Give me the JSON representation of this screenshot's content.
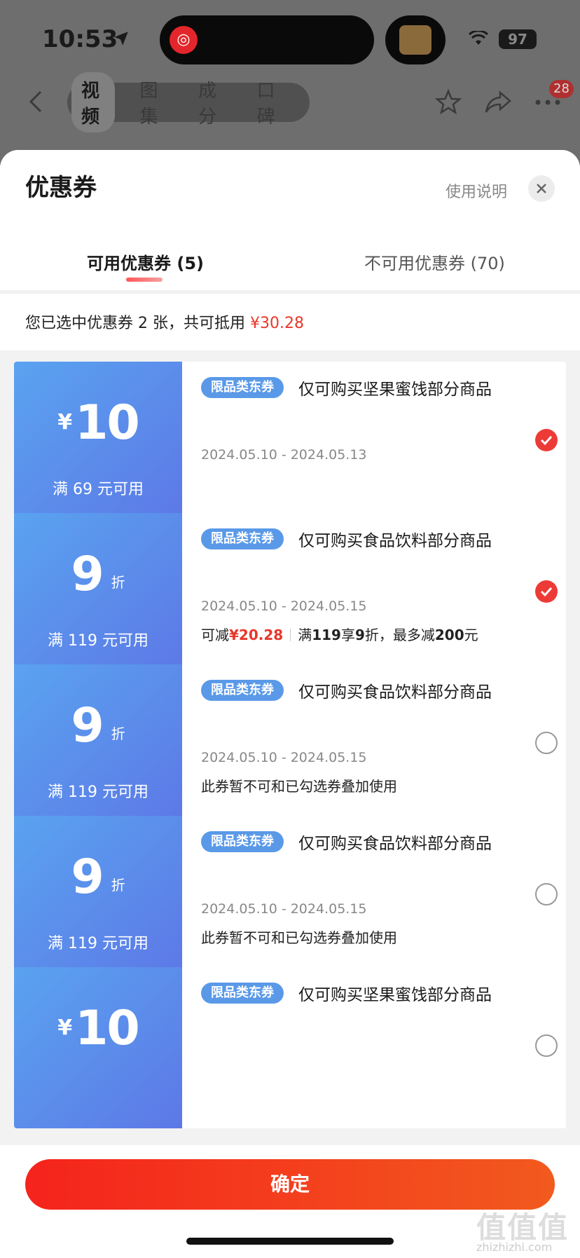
{
  "status": {
    "time": "10:53",
    "battery": "97"
  },
  "nav": {
    "tabs": [
      "视频",
      "图集",
      "成分",
      "口碑"
    ],
    "active_tab": "视频",
    "badge_count": "28"
  },
  "sheet": {
    "title": "优惠券",
    "help_link": "使用说明",
    "tab_available": "可用优惠券 (5)",
    "tab_unavailable": "不可用优惠券 (70)",
    "summary_prefix": "您已选中优惠券 2 张，共可抵用 ",
    "summary_amount": "¥30.28"
  },
  "coupons": [
    {
      "kind": "amount",
      "yen": "¥",
      "value": "10",
      "min_spend": "满 69 元可用",
      "tag": "限品类东券",
      "scope": "仅可购买坚果蜜饯部分商品",
      "dates": "2024.05.10 - 2024.05.13",
      "selected": true
    },
    {
      "kind": "discount",
      "value": "9",
      "unit": "折",
      "min_spend": "满 119 元可用",
      "tag": "限品类东券",
      "scope": "仅可购买食品饮料部分商品",
      "dates": "2024.05.10 - 2024.05.15",
      "detail_prefix": "可减",
      "detail_amount": "¥20.28",
      "detail_rule_a": "满",
      "detail_rule_b": "119",
      "detail_rule_c": "享",
      "detail_rule_d": "9",
      "detail_rule_e": "折，最多减",
      "detail_rule_f": "200",
      "detail_rule_g": "元",
      "selected": true
    },
    {
      "kind": "discount",
      "value": "9",
      "unit": "折",
      "min_spend": "满 119 元可用",
      "tag": "限品类东券",
      "scope": "仅可购买食品饮料部分商品",
      "dates": "2024.05.10 - 2024.05.15",
      "note": "此券暂不可和已勾选券叠加使用",
      "selected": false
    },
    {
      "kind": "discount",
      "value": "9",
      "unit": "折",
      "min_spend": "满 119 元可用",
      "tag": "限品类东券",
      "scope": "仅可购买食品饮料部分商品",
      "dates": "2024.05.10 - 2024.05.15",
      "note": "此券暂不可和已勾选券叠加使用",
      "selected": false
    },
    {
      "kind": "amount",
      "yen": "¥",
      "value": "10",
      "tag": "限品类东券",
      "scope": "仅可购买坚果蜜饯部分商品",
      "selected": false
    }
  ],
  "footer": {
    "confirm_label": "确定",
    "watermark": "值值值",
    "watermark_sub": "zhizhizhi.com"
  },
  "colors": {
    "accent": "#e8372a",
    "coupon_blue": "#5d78e6",
    "confirm": "#f5231c"
  },
  "icons": [
    "location-arrow-icon",
    "netease-music-icon",
    "wifi-icon",
    "back-chevron-icon",
    "star-icon",
    "share-icon",
    "more-icon",
    "close-icon",
    "checkmark-icon"
  ]
}
